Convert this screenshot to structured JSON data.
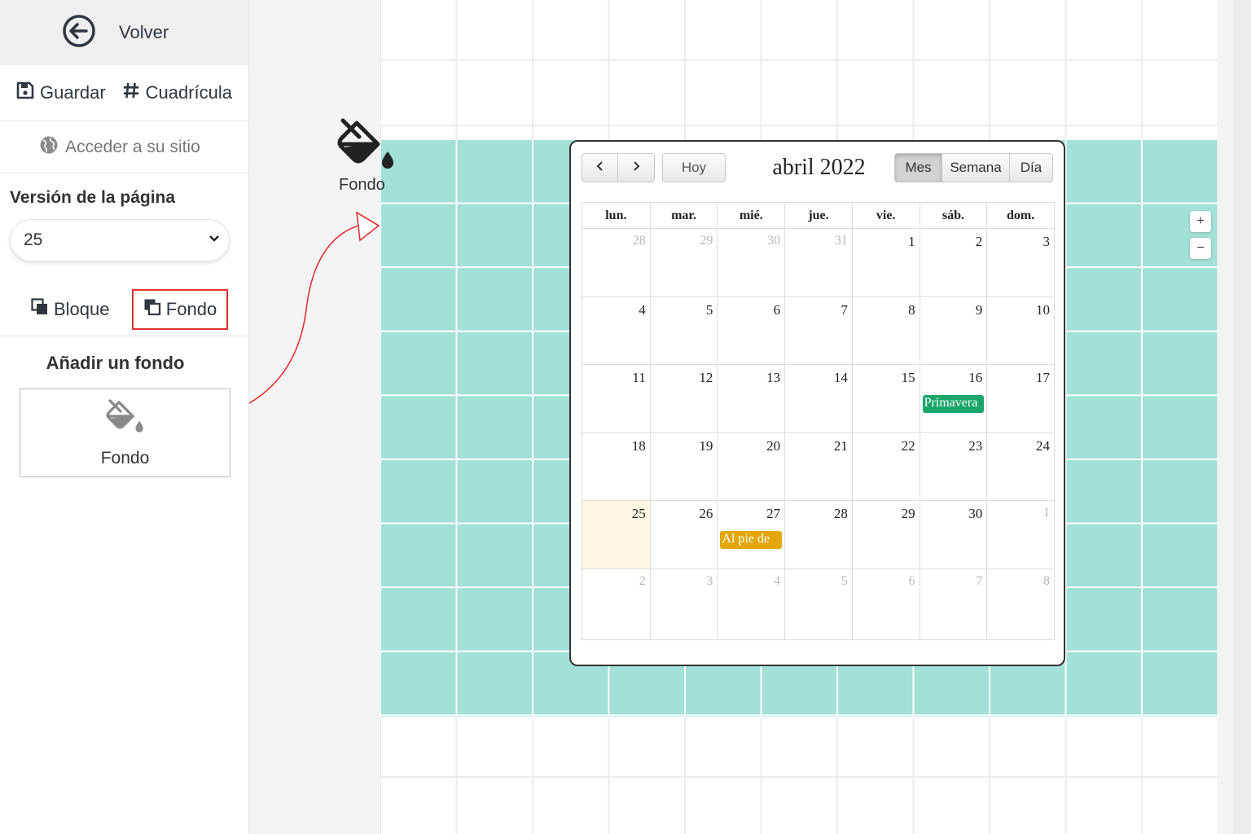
{
  "sidebar": {
    "back_label": "Volver",
    "save_label": "Guardar",
    "grid_label": "Cuadrícula",
    "site_link": "Acceder a su sitio",
    "version_title": "Versión de la página",
    "version_value": "25",
    "tabs": [
      {
        "label": "Bloque",
        "icon": "copy-icon",
        "selected": false
      },
      {
        "label": "Fondo",
        "icon": "copy-icon",
        "selected": true
      }
    ],
    "add_title": "Añadir un fondo",
    "add_card_label": "Fondo"
  },
  "canvas": {
    "dragged_item_label": "Fondo",
    "band_color": "#a3e0d6",
    "zoom_in": "+",
    "zoom_out": "−"
  },
  "calendar": {
    "title": "abril 2022",
    "today_button": "Hoy",
    "views": [
      {
        "label": "Mes",
        "active": true
      },
      {
        "label": "Semana",
        "active": false
      },
      {
        "label": "Día",
        "active": false
      }
    ],
    "weekdays": [
      "lun.",
      "mar.",
      "mié.",
      "jue.",
      "vie.",
      "sáb.",
      "dom."
    ],
    "weeks": [
      [
        {
          "d": "28",
          "o": true
        },
        {
          "d": "29",
          "o": true
        },
        {
          "d": "30",
          "o": true
        },
        {
          "d": "31",
          "o": true
        },
        {
          "d": "1"
        },
        {
          "d": "2"
        },
        {
          "d": "3"
        }
      ],
      [
        {
          "d": "4"
        },
        {
          "d": "5"
        },
        {
          "d": "6"
        },
        {
          "d": "7"
        },
        {
          "d": "8"
        },
        {
          "d": "9"
        },
        {
          "d": "10"
        }
      ],
      [
        {
          "d": "11"
        },
        {
          "d": "12"
        },
        {
          "d": "13"
        },
        {
          "d": "14"
        },
        {
          "d": "15"
        },
        {
          "d": "16",
          "event": {
            "label": "Primavera",
            "color": "#1aa56b"
          }
        },
        {
          "d": "17"
        }
      ],
      [
        {
          "d": "18"
        },
        {
          "d": "19"
        },
        {
          "d": "20"
        },
        {
          "d": "21"
        },
        {
          "d": "22"
        },
        {
          "d": "23"
        },
        {
          "d": "24"
        }
      ],
      [
        {
          "d": "25",
          "today": true
        },
        {
          "d": "26"
        },
        {
          "d": "27",
          "event": {
            "label": "Al pie de",
            "color": "#e2a70c"
          }
        },
        {
          "d": "28"
        },
        {
          "d": "29"
        },
        {
          "d": "30"
        },
        {
          "d": "1",
          "o": true
        }
      ],
      [
        {
          "d": "2",
          "o": true
        },
        {
          "d": "3",
          "o": true
        },
        {
          "d": "4",
          "o": true
        },
        {
          "d": "5",
          "o": true
        },
        {
          "d": "6",
          "o": true
        },
        {
          "d": "7",
          "o": true
        },
        {
          "d": "8",
          "o": true
        }
      ]
    ]
  },
  "colors": {
    "accent_red": "#e23232",
    "today_bg": "#fcf8e3"
  }
}
